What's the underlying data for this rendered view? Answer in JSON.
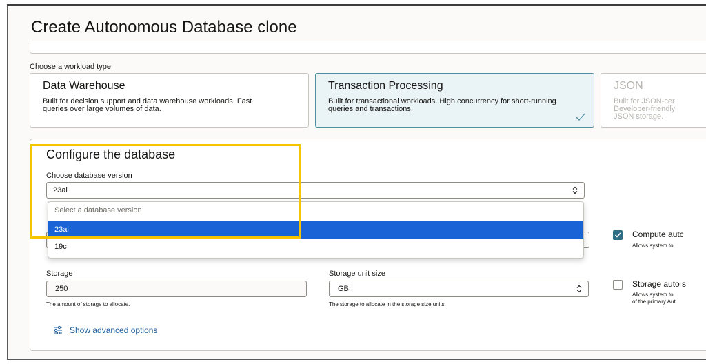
{
  "page": {
    "title": "Create Autonomous Database clone"
  },
  "workload": {
    "section_label": "Choose a workload type",
    "cards": [
      {
        "title": "Data Warehouse",
        "description": "Built for decision support and data warehouse workloads. Fast queries over large volumes of data.",
        "selected": false
      },
      {
        "title": "Transaction Processing",
        "description": "Built for transactional workloads. High concurrency for short-running queries and transactions.",
        "selected": true
      },
      {
        "title": "JSON",
        "description": "Built for JSON-cer Developer-friendly JSON storage.",
        "selected": false
      }
    ]
  },
  "configure": {
    "title": "Configure the database",
    "version_label": "Choose database version",
    "version_value": "23ai",
    "dropdown": {
      "placeholder": "Select a database version",
      "options": [
        "23ai",
        "19c"
      ],
      "highlighted": "23ai"
    },
    "compute_auto": {
      "label": "Compute autc",
      "help": "Allows system to",
      "checked": true
    },
    "storage": {
      "label": "Storage",
      "value": "250",
      "help": "The amount of storage to allocate."
    },
    "storage_unit": {
      "label": "Storage unit size",
      "value": "GB",
      "help": "The storage to allocate in the storage size units."
    },
    "storage_auto": {
      "label": "Storage auto s",
      "help_line1": "Allows system to",
      "help_line2": "of the primary Aut",
      "checked": false
    },
    "advanced_link": "Show advanced options"
  },
  "colors": {
    "accent": "#1a63d6",
    "highlight_box": "#f7c400",
    "link": "#1f5e9c",
    "selected_card": "#eaf3f6"
  }
}
